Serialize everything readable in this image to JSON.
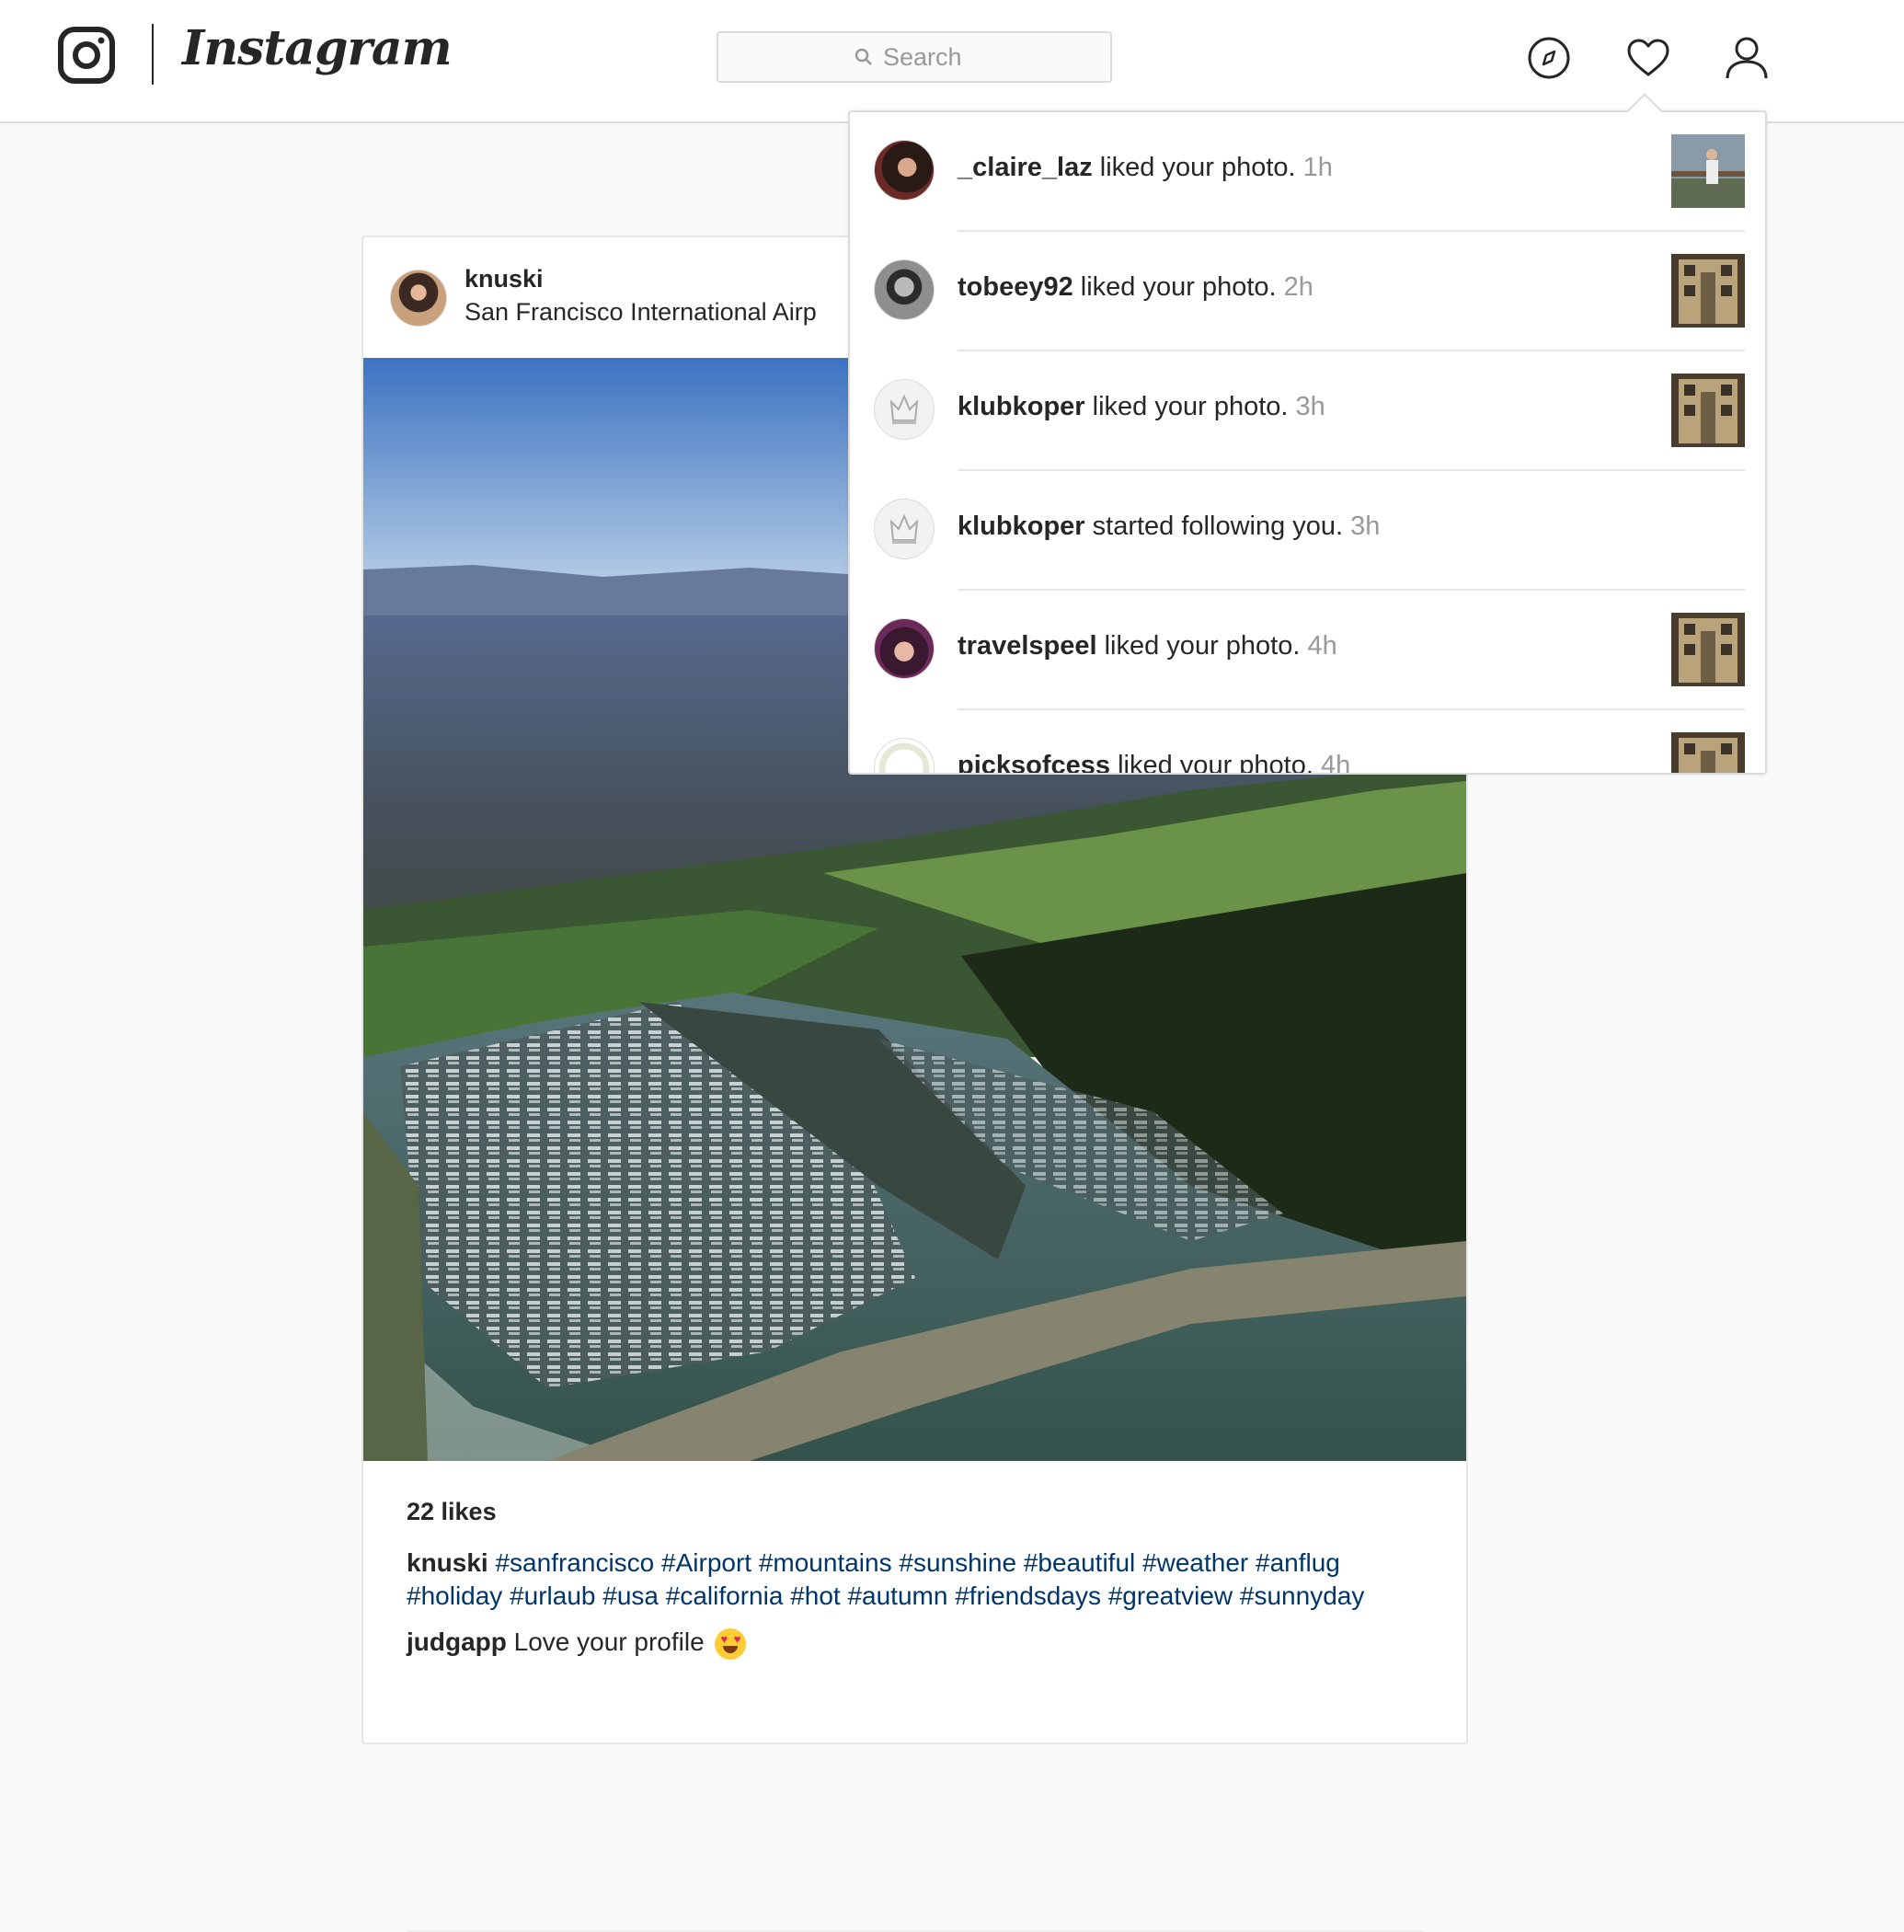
{
  "nav": {
    "logo_text": "Instagram",
    "search_placeholder": "Search",
    "icons": [
      "explore-icon",
      "heart-icon",
      "profile-icon"
    ]
  },
  "post": {
    "username": "knuski",
    "location": "San Francisco International Airp",
    "likes": "22 likes",
    "caption_user": "knuski",
    "hashtags": "#sanfrancisco #Airport #mountains #sunshine #beautiful #weather #anflug #holiday #urlaub #usa #california #hot #autumn #friendsdays #greatview #sunnyday",
    "comment_user": "judgapp",
    "comment_text": "Love your profile"
  },
  "notifications": [
    {
      "user": "_claire_laz",
      "action": "liked your photo.",
      "time": "1h"
    },
    {
      "user": "tobeey92",
      "action": "liked your photo.",
      "time": "2h"
    },
    {
      "user": "klubkoper",
      "action": "liked your photo.",
      "time": "3h"
    },
    {
      "user": "klubkoper",
      "action": "started following you.",
      "time": "3h"
    },
    {
      "user": "travelspeel",
      "action": "liked your photo.",
      "time": "4h"
    },
    {
      "user": "picksofcess",
      "action": "liked your photo.",
      "time": "4h"
    }
  ],
  "colors": {
    "hashtag": "#003569",
    "time": "#999999",
    "border": "#dbdbdb"
  }
}
